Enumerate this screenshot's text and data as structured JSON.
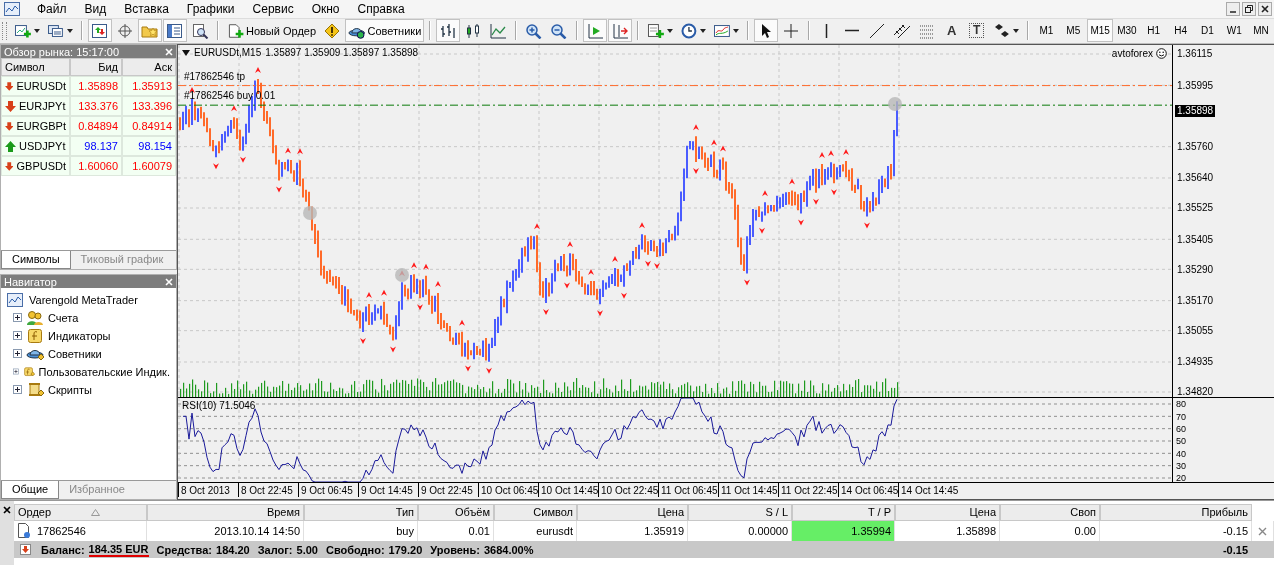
{
  "menu": [
    {
      "label": "Файл"
    },
    {
      "label": "Вид"
    },
    {
      "label": "Вставка"
    },
    {
      "label": "Графики"
    },
    {
      "label": "Сервис"
    },
    {
      "label": "Окно"
    },
    {
      "label": "Справка"
    }
  ],
  "toolbar": {
    "items": [
      {
        "kind": "new-chart",
        "pressed": false,
        "dropdown": true
      },
      {
        "kind": "profiles",
        "pressed": false,
        "dropdown": true
      },
      {
        "kind": "separator"
      },
      {
        "kind": "market-watch",
        "pressed": true
      },
      {
        "kind": "data-window",
        "pressed": false
      },
      {
        "kind": "favorites",
        "pressed": true
      },
      {
        "kind": "navigator",
        "pressed": true
      },
      {
        "kind": "tester",
        "pressed": false
      },
      {
        "kind": "separator"
      },
      {
        "kind": "new-order",
        "pressed": false,
        "label": "Новый Ордер"
      },
      {
        "kind": "warning",
        "pressed": false
      },
      {
        "kind": "experts",
        "pressed": true,
        "label": "Советники"
      },
      {
        "kind": "separator"
      },
      {
        "kind": "bar-chart",
        "pressed": true
      },
      {
        "kind": "candles",
        "pressed": false
      },
      {
        "kind": "line-chart",
        "pressed": false
      },
      {
        "kind": "separator"
      },
      {
        "kind": "zoom-in",
        "pressed": false
      },
      {
        "kind": "zoom-out",
        "pressed": false
      },
      {
        "kind": "separator"
      },
      {
        "kind": "autoscroll",
        "pressed": true
      },
      {
        "kind": "chart-shift",
        "pressed": true
      },
      {
        "kind": "separator"
      },
      {
        "kind": "templates",
        "pressed": false,
        "dropdown": true
      },
      {
        "kind": "periods",
        "pressed": false,
        "dropdown": true
      },
      {
        "kind": "indicators",
        "pressed": false,
        "dropdown": true
      },
      {
        "kind": "separator"
      },
      {
        "kind": "cursor",
        "pressed": true
      },
      {
        "kind": "crosshair",
        "pressed": false
      },
      {
        "kind": "separator"
      },
      {
        "kind": "vertical-line",
        "pressed": false
      },
      {
        "kind": "horizontal-line",
        "pressed": false
      },
      {
        "kind": "trend-line",
        "pressed": false
      },
      {
        "kind": "channel",
        "pressed": false
      },
      {
        "kind": "fibonacci",
        "pressed": false
      },
      {
        "kind": "text",
        "pressed": false,
        "label": "A"
      },
      {
        "kind": "text-label",
        "pressed": false,
        "label": "T"
      },
      {
        "kind": "arrows",
        "pressed": false,
        "dropdown": true
      },
      {
        "kind": "separator"
      }
    ],
    "timeframes": [
      {
        "label": "M1",
        "selected": false
      },
      {
        "label": "M5",
        "selected": false
      },
      {
        "label": "M15",
        "selected": true
      },
      {
        "label": "M30",
        "selected": false
      },
      {
        "label": "H1",
        "selected": false
      },
      {
        "label": "H4",
        "selected": false
      },
      {
        "label": "D1",
        "selected": false
      },
      {
        "label": "W1",
        "selected": false
      },
      {
        "label": "MN",
        "selected": false
      }
    ]
  },
  "market_watch": {
    "title": "Обзор рынка: 15:17:00",
    "columns": [
      "Символ",
      "Бид",
      "Аск"
    ],
    "rows": [
      {
        "symbol": "EURUSDt",
        "bid": "1.35898",
        "ask": "1.35913",
        "rising": false
      },
      {
        "symbol": "EURJPYt",
        "bid": "133.376",
        "ask": "133.396",
        "rising": false
      },
      {
        "symbol": "EURGBPt",
        "bid": "0.84894",
        "ask": "0.84914",
        "rising": false
      },
      {
        "symbol": "USDJPYt",
        "bid": "98.137",
        "ask": "98.154",
        "rising": true
      },
      {
        "symbol": "GBPUSDt",
        "bid": "1.60060",
        "ask": "1.60079",
        "rising": false
      }
    ],
    "tabs": [
      {
        "label": "Символы",
        "selected": true
      },
      {
        "label": "Тиковый график",
        "selected": false
      }
    ]
  },
  "navigator": {
    "title": "Навигатор",
    "root": "Varengold MetaTrader",
    "items": [
      {
        "label": "Счета",
        "kind": "accounts",
        "expanded": false
      },
      {
        "label": "Индикаторы",
        "kind": "indicators",
        "expanded": false
      },
      {
        "label": "Советники",
        "kind": "experts",
        "expanded": false
      },
      {
        "label": "Пользовательские Индик.",
        "kind": "custom-indicators",
        "expanded": false
      },
      {
        "label": "Скрипты",
        "kind": "scripts",
        "expanded": false
      }
    ],
    "tabs": [
      {
        "label": "Общие",
        "selected": true
      },
      {
        "label": "Избранное",
        "selected": false
      }
    ]
  },
  "chart": {
    "symbol": "EURUSDt,M15",
    "ohlc": "1.35897 1.35909 1.35897 1.35898",
    "order_labels": [
      {
        "text": "#17862546 tp",
        "kind": "take-profit"
      },
      {
        "text": "#17862546 buy 0.01",
        "kind": "open"
      }
    ],
    "expert": "avtoforex",
    "price_ticks": [
      "1.36115",
      "1.35995",
      "1.35760",
      "1.35640",
      "1.35525",
      "1.35405",
      "1.35290",
      "1.35170",
      "1.35055",
      "1.34935",
      "1.34820"
    ],
    "current_price": "1.35898",
    "indicator": "RSI(10) 71.5046",
    "indicator_ticks": [
      "80",
      "70",
      "60",
      "50",
      "40",
      "30",
      "20"
    ],
    "time_ticks": [
      "8 Oct 2013",
      "8 Oct 22:45",
      "9 Oct 06:45",
      "9 Oct 14:45",
      "9 Oct 22:45",
      "10 Oct 06:45",
      "10 Oct 14:45",
      "10 Oct 22:45",
      "11 Oct 06:45",
      "11 Oct 14:45",
      "11 Oct 22:45",
      "14 Oct 06:45",
      "14 Oct 14:45"
    ]
  },
  "terminal": {
    "columns": [
      {
        "label": "Ордер",
        "sorted": true
      },
      {
        "label": "Время",
        "sorted": false
      },
      {
        "label": "Тип",
        "sorted": false
      },
      {
        "label": "Объём",
        "sorted": false
      },
      {
        "label": "Символ",
        "sorted": false
      },
      {
        "label": "Цена",
        "sorted": false
      },
      {
        "label": "S / L",
        "sorted": false
      },
      {
        "label": "T / P",
        "sorted": false
      },
      {
        "label": "Цена",
        "sorted": false
      },
      {
        "label": "Своп",
        "sorted": false
      },
      {
        "label": "Прибыль",
        "sorted": false
      }
    ],
    "rows": [
      {
        "cells": [
          {
            "text": "17862546",
            "highlighted": false
          },
          {
            "text": "2013.10.14 14:50",
            "highlighted": false
          },
          {
            "text": "buy",
            "highlighted": false
          },
          {
            "text": "0.01",
            "highlighted": false
          },
          {
            "text": "eurusdt",
            "highlighted": false
          },
          {
            "text": "1.35919",
            "highlighted": false
          },
          {
            "text": "0.00000",
            "highlighted": false
          },
          {
            "text": "1.35994",
            "highlighted": true
          },
          {
            "text": "1.35898",
            "highlighted": false
          },
          {
            "text": "0.00",
            "highlighted": false
          },
          {
            "text": "-0.15",
            "highlighted": false
          }
        ]
      }
    ],
    "summary": {
      "items": [
        {
          "label": "Баланс:",
          "value": "184.35 EUR",
          "underlined": true
        },
        {
          "label": "Средства:",
          "value": "184.20",
          "underlined": false
        },
        {
          "label": "Залог:",
          "value": "5.00",
          "underlined": false
        },
        {
          "label": "Свободно:",
          "value": "179.20",
          "underlined": false
        },
        {
          "label": "Уровень:",
          "value": "3684.00%",
          "underlined": false
        }
      ],
      "total": "-0.15"
    }
  }
}
